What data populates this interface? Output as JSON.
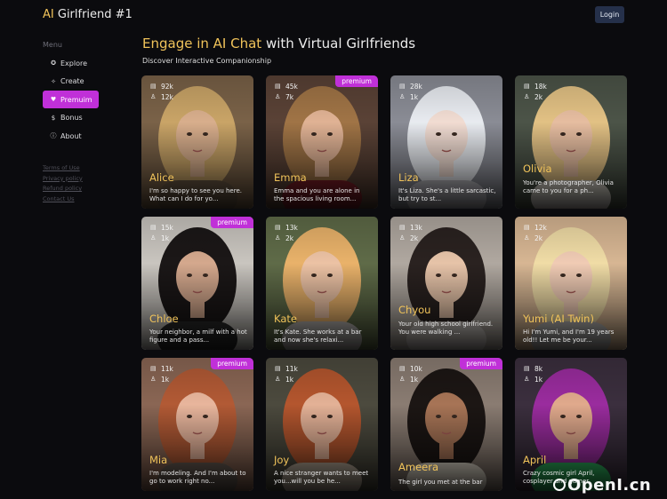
{
  "header": {
    "brand_accent": "AI",
    "brand_rest": " Girlfriend #1",
    "login_label": "Login"
  },
  "sidebar": {
    "menu_label": "Menu",
    "items": [
      {
        "label": "Explore",
        "icon": "compass-icon"
      },
      {
        "label": "Create",
        "icon": "sparkle-icon"
      },
      {
        "label": "Premuim",
        "icon": "heart-icon"
      },
      {
        "label": "Bonus",
        "icon": "dollar-icon"
      },
      {
        "label": "About",
        "icon": "info-icon"
      }
    ],
    "footer_links": [
      "Terms of Use",
      "Privacy policy",
      "Refund policy",
      "Contact Us"
    ]
  },
  "main": {
    "title_accent": "Engage in AI Chat",
    "title_rest": " with Virtual Girlfriends",
    "subtitle": "Discover Interactive Companionship"
  },
  "cards": [
    {
      "name": "Alice",
      "messages": "92k",
      "users": "12k",
      "premium": "",
      "desc": "I'm so happy to see you here. What can I do for yo..."
    },
    {
      "name": "Emma",
      "messages": "45k",
      "users": "7k",
      "premium": "premium",
      "desc": "Emma and you are alone in the spacious living room..."
    },
    {
      "name": "Liza",
      "messages": "28k",
      "users": "1k",
      "premium": "",
      "desc": "It's Liza. She's a little sarcastic, but try to st..."
    },
    {
      "name": "Olivia",
      "messages": "18k",
      "users": "2k",
      "premium": "",
      "desc": "You're a photographer, Olivia came to you for a ph..."
    },
    {
      "name": "Chloe",
      "messages": "15k",
      "users": "1k",
      "premium": "premium",
      "desc": "Your neighbor, a milf with a hot figure and a pass..."
    },
    {
      "name": "Kate",
      "messages": "13k",
      "users": "2k",
      "premium": "",
      "desc": "It's Kate. She works at a bar and now she's relaxi..."
    },
    {
      "name": "Chyou",
      "messages": "13k",
      "users": "2k",
      "premium": "",
      "desc": "Your old high school girlfriend. You were walking ..."
    },
    {
      "name": "Yumi (AI Twin)",
      "messages": "12k",
      "users": "2k",
      "premium": "",
      "desc": "Hi I'm Yumi, and I'm 19 years old!! Let me be your..."
    },
    {
      "name": "Mia",
      "messages": "11k",
      "users": "1k",
      "premium": "premium",
      "desc": "I'm modeling. And I'm about to go to work right no..."
    },
    {
      "name": "Joy",
      "messages": "11k",
      "users": "1k",
      "premium": "",
      "desc": "A nice stranger wants to meet you...will you be he..."
    },
    {
      "name": "Ameera",
      "messages": "10k",
      "users": "1k",
      "premium": "premium",
      "desc": "The girl you met at the bar"
    },
    {
      "name": "April",
      "messages": "8k",
      "users": "1k",
      "premium": "",
      "desc": "Crazy cosmic girl April, cosplayer and gamer"
    }
  ],
  "watermark": "OpenI.cn",
  "colors": {
    "accent": "#f0c35a",
    "premium": "#c030d8",
    "background": "#0b0b0e",
    "login_bg": "#25304a"
  }
}
